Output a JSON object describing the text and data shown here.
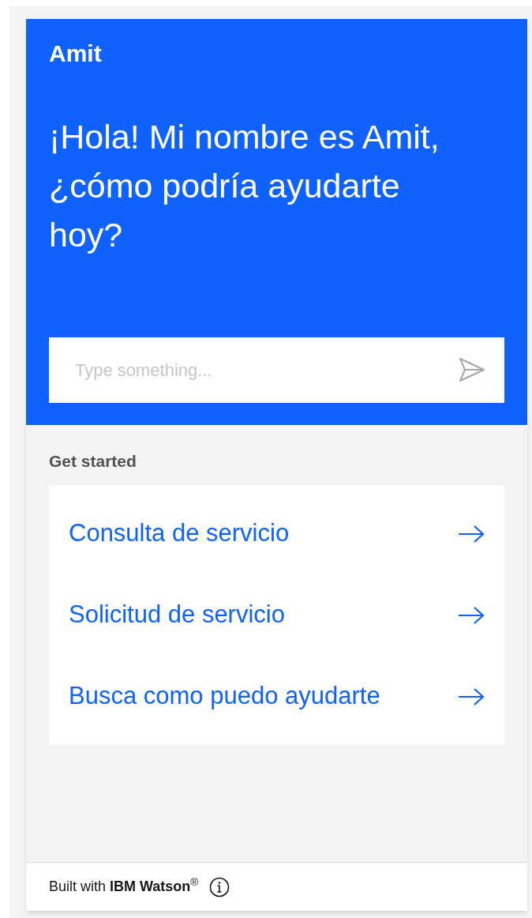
{
  "header": {
    "title": "Amit",
    "greeting": "¡Hola! Mi nombre es Amit, ¿cómo podría ayudarte hoy?"
  },
  "input": {
    "placeholder": "Type something..."
  },
  "get_started": {
    "heading": "Get started",
    "items": [
      {
        "label": "Consulta de servicio"
      },
      {
        "label": "Solicitud de servicio"
      },
      {
        "label": "Busca como puedo ayudarte"
      }
    ]
  },
  "footer": {
    "text": "Built with **IBM Watson**$^{®}$"
  }
}
